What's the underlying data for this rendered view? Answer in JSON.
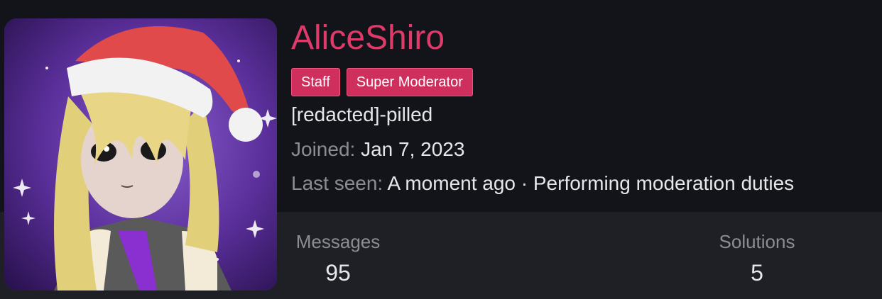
{
  "profile": {
    "username": "AliceShiro",
    "badges": [
      "Staff",
      "Super Moderator"
    ],
    "tagline": "[redacted]-pilled",
    "joined_label": "Joined:",
    "joined_value": "Jan 7, 2023",
    "last_seen_label": "Last seen:",
    "last_seen_value": "A moment ago · Performing moderation duties"
  },
  "stats": {
    "messages_label": "Messages",
    "messages_value": "95",
    "solutions_label": "Solutions",
    "solutions_value": "5"
  },
  "colors": {
    "accent": "#e03a6a",
    "badge_bg": "#cf2f5c",
    "background": "#131419",
    "stats_band": "#1e2026"
  }
}
